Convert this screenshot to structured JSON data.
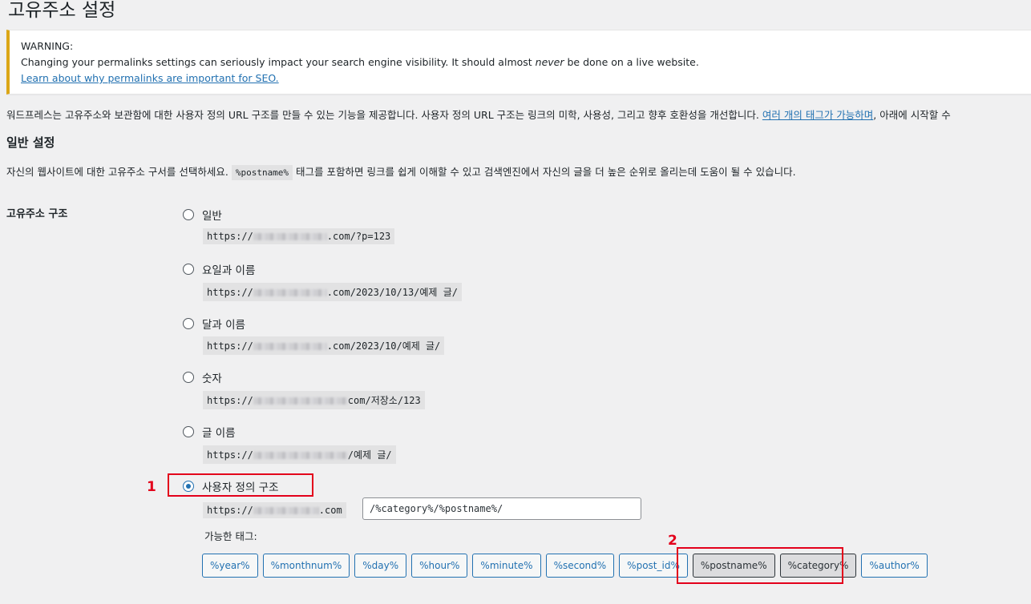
{
  "page": {
    "title": "고유주소 설정"
  },
  "notice": {
    "heading": "WARNING:",
    "body_pre": "Changing your permalinks settings can seriously impact your search engine visibility. It should almost ",
    "body_em": "never",
    "body_post": " be done on a live website.",
    "link": "Learn about why permalinks are important for SEO."
  },
  "intro": {
    "pre": "워드프레스는 고유주소와 보관함에 대한 사용자 정의 URL 구조를 만들 수 있는 기능을 제공합니다. 사용자 정의 URL 구조는 링크의 미학, 사용성, 그리고 향후 호환성을 개선합니다.",
    "link": "여러 개의 태그가 가능하며",
    "post": ", 아래에 시작할 수"
  },
  "section": {
    "title": "일반 설정",
    "desc_pre": "자신의 웹사이트에 대한 고유주소 구서를 선택하세요.",
    "desc_code": "%postname%",
    "desc_post": "태그를 포함하면 링크를 쉽게 이해할 수 있고 검색엔진에서 자신의 글을 더 높은 순위로 올리는데 도움이 될 수 있습니다."
  },
  "permalink": {
    "label": "고유주소 구조",
    "options": [
      {
        "label": "일반",
        "prefix": "https://",
        "suffix": ".com/?p=123",
        "checked": false
      },
      {
        "label": "요일과 이름",
        "prefix": "https://",
        "suffix": ".com/2023/10/13/예제 글/",
        "checked": false
      },
      {
        "label": "달과 이름",
        "prefix": "https://",
        "suffix": ".com/2023/10/예제 글/",
        "checked": false
      },
      {
        "label": "숫자",
        "prefix": "https://",
        "suffix": "com/저장소/123",
        "checked": false
      },
      {
        "label": "글 이름",
        "prefix": "https://",
        "suffix": "/예제 글/",
        "checked": false
      },
      {
        "label": "사용자 정의 구조",
        "prefix": "https://",
        "suffix": ".com",
        "checked": true
      }
    ],
    "custom_value": "/%category%/%postname%/",
    "available_tags_label": "가능한 태그:",
    "tags": [
      "%year%",
      "%monthnum%",
      "%day%",
      "%hour%",
      "%minute%",
      "%second%",
      "%post_id%",
      "%postname%",
      "%category%",
      "%author%"
    ],
    "active_tags": [
      "%postname%",
      "%category%"
    ]
  },
  "annotations": {
    "marker_1": "1",
    "marker_2": "2",
    "highlight_color": "#e3001b"
  },
  "colors": {
    "link": "#2271b1",
    "warning_border": "#dba617",
    "background": "#f0f0f1"
  }
}
